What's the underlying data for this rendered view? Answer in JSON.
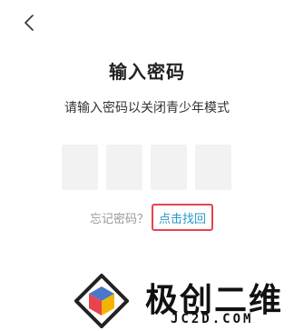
{
  "header": {
    "back_icon": "chevron-left-icon"
  },
  "title": "输入密码",
  "subtitle": "请输入密码以关闭青少年模式",
  "code_inputs": [
    "",
    "",
    "",
    ""
  ],
  "forgot": {
    "label": "忘记密码？",
    "link": "点击找回",
    "link_color": "#2a98c9",
    "highlight_color": "#e8434f"
  },
  "watermark": {
    "brand": "极创二维",
    "domain": "JC2D.COM"
  }
}
